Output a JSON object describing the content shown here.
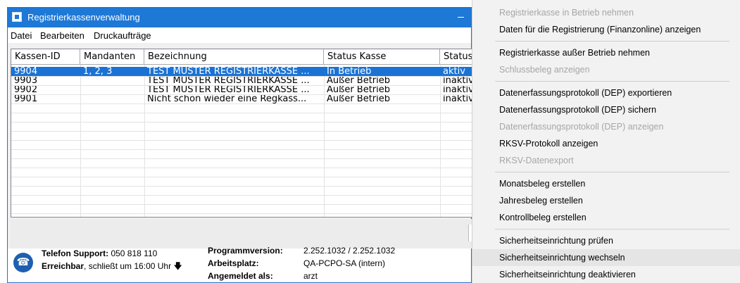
{
  "window": {
    "title": "Registrierkassenverwaltung"
  },
  "menubar": [
    "Datei",
    "Bearbeiten",
    "Druckaufträge"
  ],
  "table": {
    "columns": [
      "Kassen-ID",
      "Mandanten",
      "Bezeichnung",
      "Status Kasse",
      "Status"
    ],
    "rows": [
      [
        "9904",
        "1, 2, 3",
        "TEST MUSTER REGISTRIERKASSE ...",
        "In Betrieb",
        "aktiv"
      ],
      [
        "9903",
        "",
        "TEST MUSTER REGISTRIERKASSE ...",
        "Außer Betrieb",
        "inaktiv"
      ],
      [
        "9902",
        "",
        "TEST MUSTER REGISTRIERKASSE ...",
        "Außer Betrieb",
        "inaktiv"
      ],
      [
        "9901",
        "",
        "Nicht schon wieder eine Regkass...",
        "Außer Betrieb",
        "inaktiv"
      ]
    ],
    "selected_row": 0
  },
  "status": {
    "phone_label": "Telefon Support:",
    "phone_number": "050 818 110",
    "reach_label": "Erreichbar",
    "reach_text": ", schließt um 16:00 Uhr",
    "prog_label": "Programmversion:",
    "prog_value": "2.252.1032 / 2.252.1032",
    "ws_label": "Arbeitsplatz:",
    "ws_value": "QA-PCPO-SA (intern)",
    "user_label": "Angemeldet als:",
    "user_value": "arzt"
  },
  "context_menu": {
    "items": [
      {
        "label": "Registrierkasse in Betrieb nehmen",
        "disabled": true
      },
      {
        "label": "Daten für die Registrierung (Finanzonline) anzeigen",
        "disabled": false
      },
      {
        "separator": true
      },
      {
        "label": "Registrierkasse außer Betrieb nehmen",
        "disabled": false
      },
      {
        "label": "Schlussbeleg anzeigen",
        "disabled": true
      },
      {
        "separator": true
      },
      {
        "label": "Datenerfassungsprotokoll (DEP) exportieren",
        "disabled": false
      },
      {
        "label": "Datenerfassungsprotokoll (DEP) sichern",
        "disabled": false
      },
      {
        "label": "Datenerfassungsprotokoll (DEP) anzeigen",
        "disabled": true
      },
      {
        "label": "RKSV-Protokoll anzeigen",
        "disabled": false
      },
      {
        "label": "RKSV-Datenexport",
        "disabled": true
      },
      {
        "separator": true
      },
      {
        "label": "Monatsbeleg erstellen",
        "disabled": false
      },
      {
        "label": "Jahresbeleg erstellen",
        "disabled": false
      },
      {
        "label": "Kontrollbeleg erstellen",
        "disabled": false
      },
      {
        "separator": true
      },
      {
        "label": "Sicherheitseinrichtung prüfen",
        "disabled": false
      },
      {
        "label": "Sicherheitseinrichtung wechseln",
        "disabled": false,
        "highlighted": true
      },
      {
        "label": "Sicherheitseinrichtung deaktivieren",
        "disabled": false
      }
    ]
  }
}
